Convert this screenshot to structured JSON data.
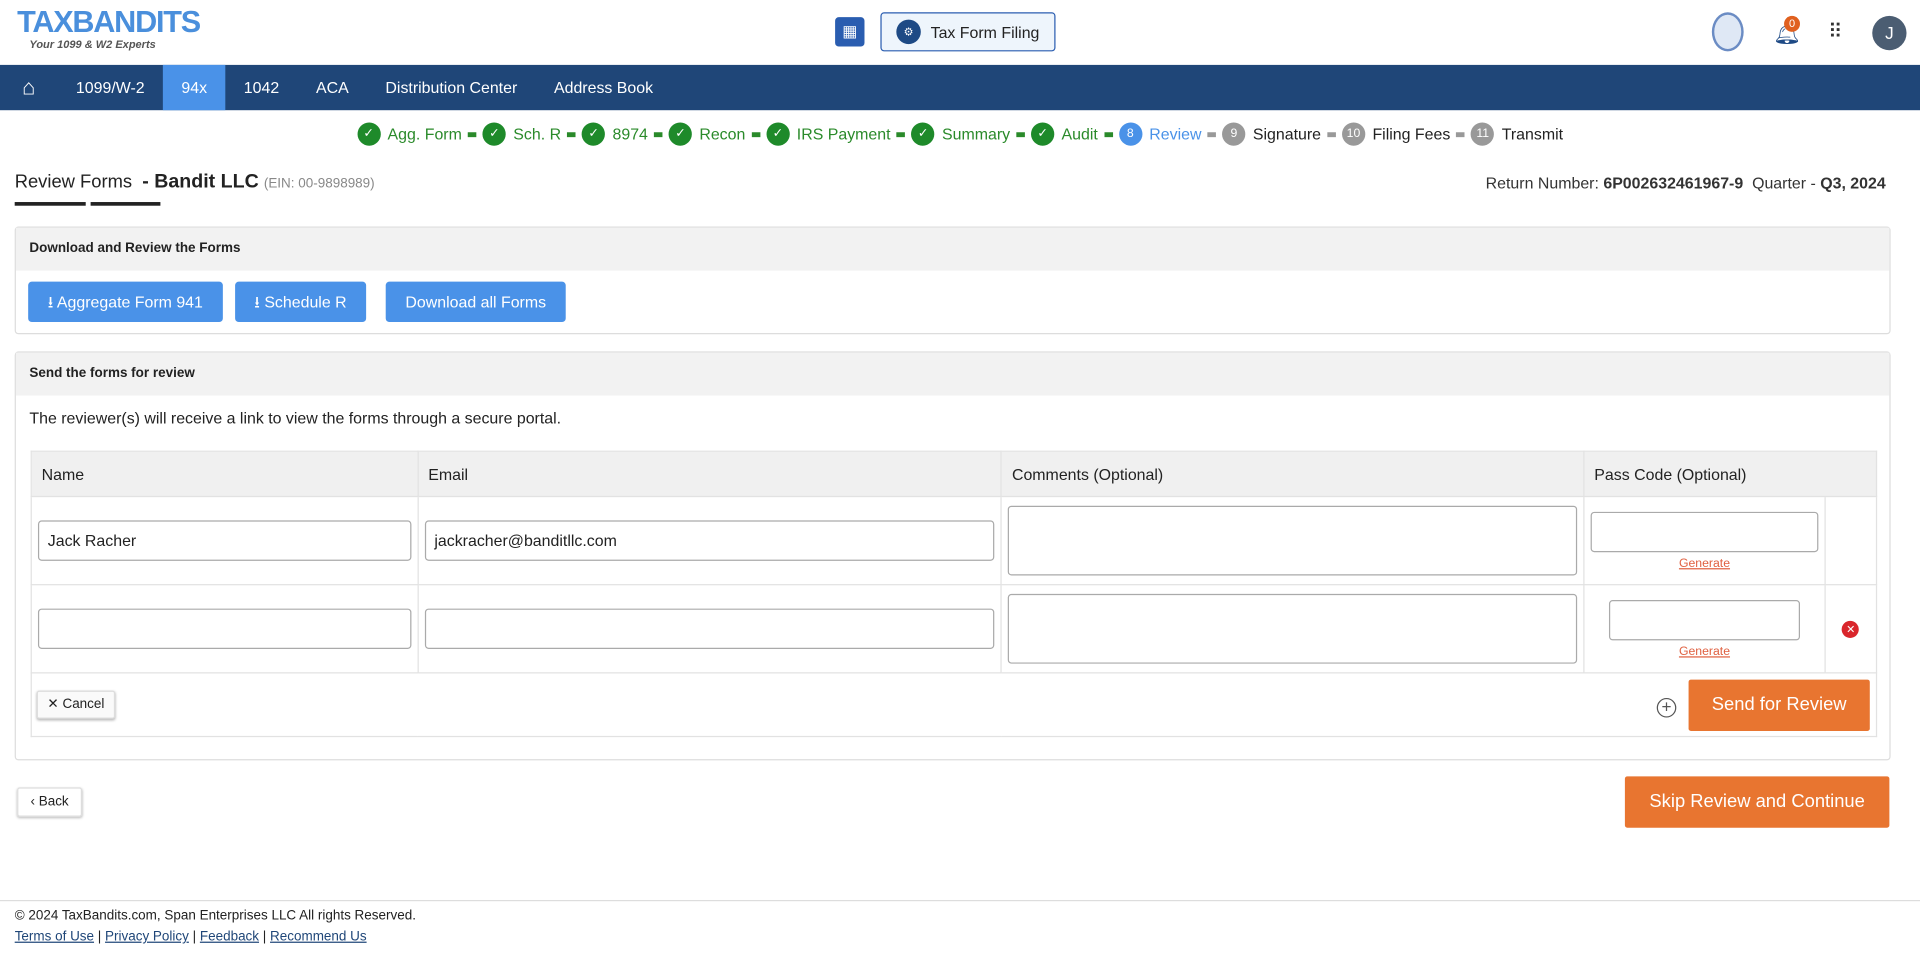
{
  "header": {
    "logo": "TAXBANDITS",
    "logo_tagline": "Your 1099 & W2 Experts",
    "product_button": "Tax Form Filing",
    "notification_count": "0",
    "avatar_initial": "J"
  },
  "nav": {
    "items": [
      "1099/W-2",
      "94x",
      "1042",
      "ACA",
      "Distribution Center",
      "Address Book"
    ],
    "active": "94x"
  },
  "steps": [
    {
      "label": "Agg. Form",
      "state": "done"
    },
    {
      "label": "Sch. R",
      "state": "done"
    },
    {
      "label": "8974",
      "state": "done"
    },
    {
      "label": "Recon",
      "state": "done"
    },
    {
      "label": "IRS Payment",
      "state": "done"
    },
    {
      "label": "Summary",
      "state": "done"
    },
    {
      "label": "Audit",
      "state": "done"
    },
    {
      "num": "8",
      "label": "Review",
      "state": "current"
    },
    {
      "num": "9",
      "label": "Signature",
      "state": "todo"
    },
    {
      "num": "10",
      "label": "Filing Fees",
      "state": "todo"
    },
    {
      "num": "11",
      "label": "Transmit",
      "state": "todo"
    }
  ],
  "page": {
    "title": "Review Forms",
    "business": "- Bandit LLC",
    "ein": "(EIN: 00-9898989)",
    "return_label": "Return Number:",
    "return_number": "6P002632461967-9",
    "quarter_label": "Quarter -",
    "quarter": "Q3, 2024"
  },
  "download": {
    "heading": "Download and Review the Forms",
    "buttons": [
      "Aggregate Form 941",
      "Schedule R",
      "Download all Forms"
    ]
  },
  "review": {
    "heading": "Send the forms for review",
    "description": "The reviewer(s) will receive a link to view the forms through a secure portal.",
    "columns": [
      "Name",
      "Email",
      "Comments (Optional)",
      "Pass Code (Optional)"
    ],
    "rows": [
      {
        "name": "Jack Racher",
        "email": "jackracher@banditllc.com",
        "comments": "",
        "passcode": "",
        "generate": "Generate"
      },
      {
        "name": "",
        "email": "",
        "comments": "",
        "passcode": "",
        "generate": "Generate"
      }
    ],
    "cancel": "Cancel",
    "send": "Send for Review"
  },
  "actions": {
    "back": "Back",
    "skip": "Skip Review and Continue"
  },
  "footer": {
    "copyright": "© 2024 TaxBandits.com, Span Enterprises LLC All rights Reserved.",
    "links": [
      "Terms of Use",
      "Privacy Policy",
      "Feedback",
      "Recommend Us"
    ]
  },
  "colors": {
    "nav": "#1f4678",
    "active_tab": "#4a92e8",
    "primary_button": "#4a92e8",
    "orange_button": "#e87530",
    "done_step": "#1e8a2a"
  }
}
